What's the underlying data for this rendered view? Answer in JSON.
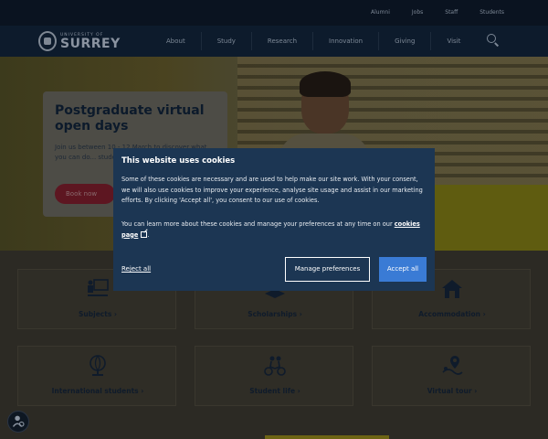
{
  "utility_links": [
    "Alumni",
    "Jobs",
    "Staff",
    "Students"
  ],
  "logo": {
    "small": "UNIVERSITY OF",
    "big": "SURREY"
  },
  "nav": [
    "About",
    "Study",
    "Research",
    "Innovation",
    "Giving",
    "Visit"
  ],
  "hero": {
    "title": "Postgraduate virtual open days",
    "desc": "Join us between 10 - 12 March to discover what you can do... student at Surrey.",
    "button": "Book now"
  },
  "tiles": [
    {
      "label": "Subjects ›",
      "icon": "presentation-icon"
    },
    {
      "label": "Scholarships ›",
      "icon": "graduation-cap-icon"
    },
    {
      "label": "Accommodation ›",
      "icon": "house-icon"
    },
    {
      "label": "International students ›",
      "icon": "globe-icon"
    },
    {
      "label": "Student life ›",
      "icon": "cycling-icon"
    },
    {
      "label": "Virtual tour ›",
      "icon": "map-pin-icon"
    }
  ],
  "cookie": {
    "heading": "This website uses cookies",
    "p1": "Some of these cookies are necessary and are used to help make our site work. With your consent, we will also use cookies to improve your experience, analyse site usage and assist in our marketing efforts. By clicking 'Accept all', you consent to our use of cookies.",
    "p2_before": "You can learn more about these cookies and manage your preferences at any time on our ",
    "p2_link": "cookies page",
    "p2_after": ".",
    "reject": "Reject all",
    "manage": "Manage preferences",
    "accept": "Accept all"
  },
  "colors": {
    "modal_bg": "#1c3653",
    "accept_btn": "#3a7bd5",
    "nav_bg": "#0d1b2c"
  }
}
